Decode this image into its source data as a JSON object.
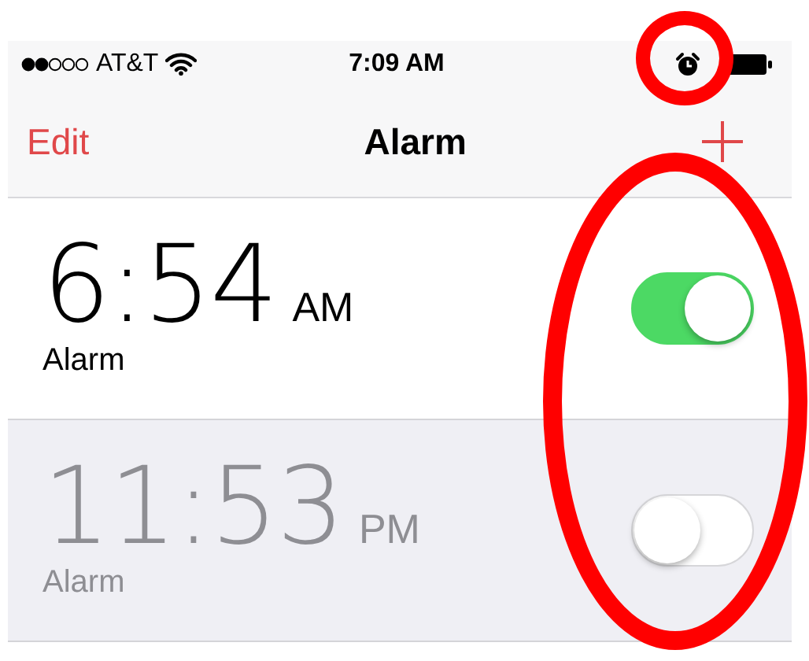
{
  "status_bar": {
    "carrier": "AT&T",
    "time": "7:09 AM"
  },
  "nav_bar": {
    "edit": "Edit",
    "title": "Alarm"
  },
  "alarms": [
    {
      "time": "6:54",
      "period": "AM",
      "label": "Alarm",
      "on": true
    },
    {
      "time": "11:53",
      "period": "PM",
      "label": "Alarm",
      "on": false
    }
  ],
  "annotations": {
    "status_alarm_circled": true,
    "switches_circled": true
  }
}
